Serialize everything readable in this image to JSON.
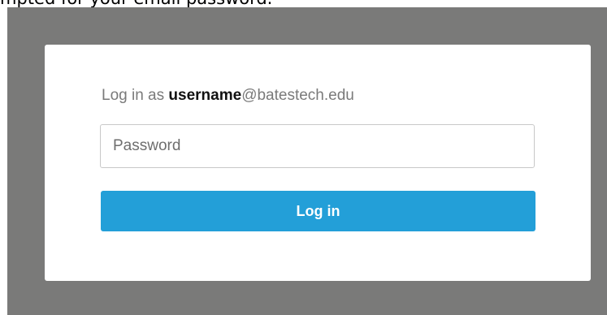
{
  "caption": {
    "text": "mpted for your email password."
  },
  "login": {
    "prefix": "Log in as ",
    "username": "username",
    "domain": "@batestech.edu",
    "password_placeholder": "Password",
    "button_label": "Log in"
  },
  "colors": {
    "backdrop": "#7a7a79",
    "dialog": "#ffffff",
    "button": "#239fd8",
    "button_text": "#ffffff",
    "heading_gray": "#7a7a7a"
  }
}
